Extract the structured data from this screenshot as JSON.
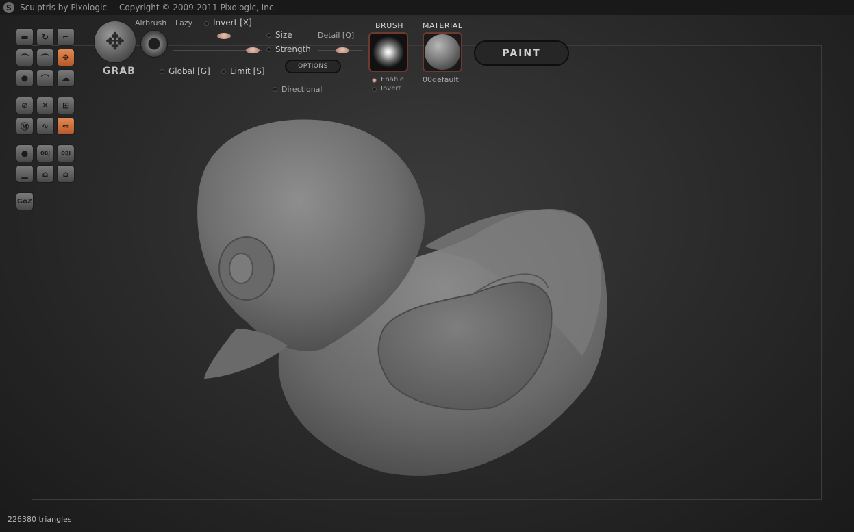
{
  "window": {
    "title": "Sculptris by Pixologic",
    "copyright": "Copyright © 2009-2011 Pixologic, Inc."
  },
  "tool": {
    "name": "GRAB",
    "airbrush_label": "Airbrush",
    "lazy_label": "Lazy",
    "invert_label": "Invert [X]",
    "size_label": "Size",
    "strength_label": "Strength",
    "detail_label": "Detail [Q]",
    "global_label": "Global [G]",
    "limit_label": "Limit [S]",
    "options_label": "OPTIONS",
    "directional_label": "Directional",
    "size_value": 0.58,
    "strength_value": 0.9,
    "detail_value": 0.55
  },
  "brush": {
    "title": "BRUSH",
    "enable_label": "Enable",
    "invert_label": "Invert"
  },
  "material": {
    "title": "MATERIAL",
    "name": "00default"
  },
  "paint_label": "PAINT",
  "toolbar": {
    "goz_label": "GoZ",
    "obj_label": "OBJ"
  },
  "status": {
    "triangles": "226380 triangles"
  },
  "colors": {
    "accent_orange": "#d47a45",
    "slider_knob": "#d4a89a"
  }
}
